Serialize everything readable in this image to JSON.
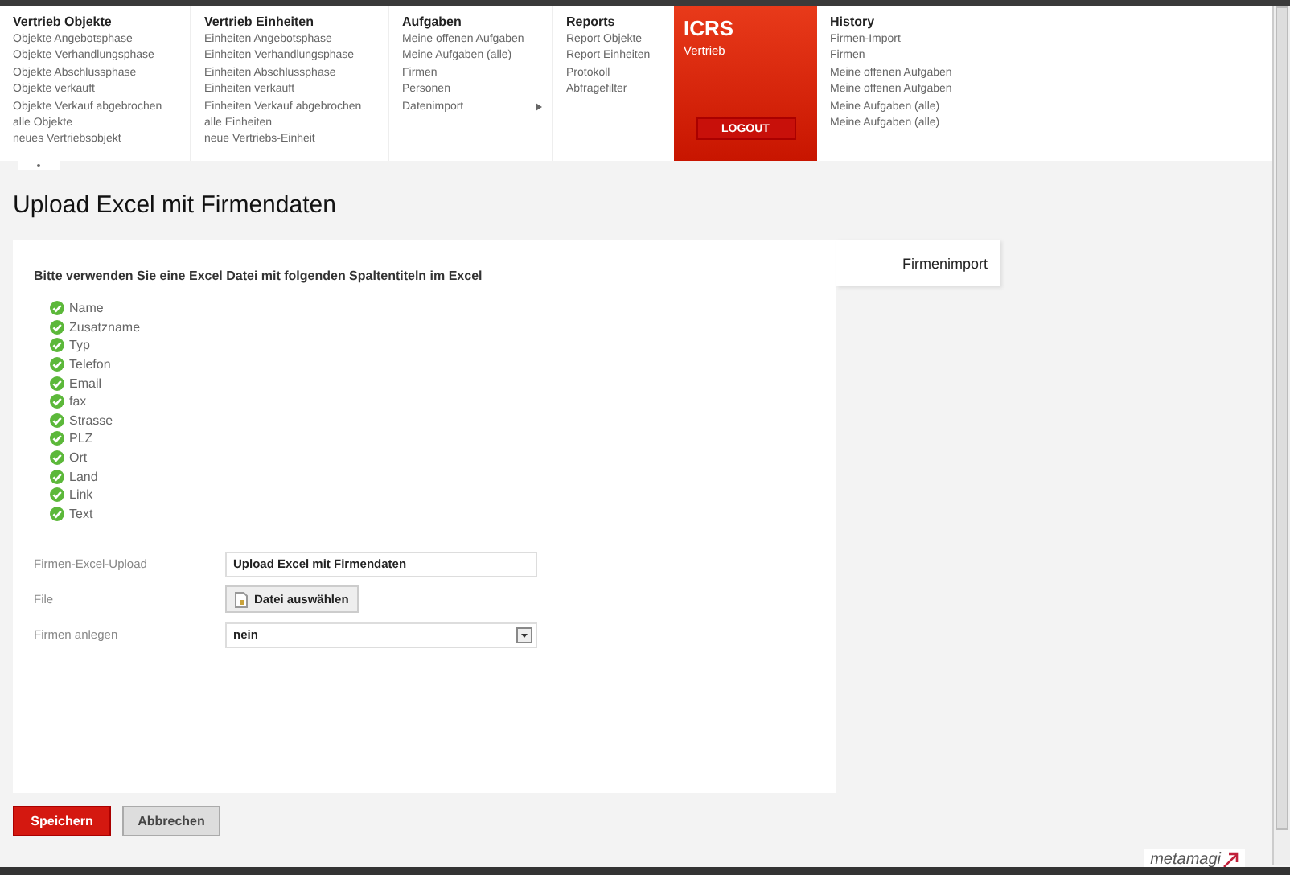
{
  "menu": {
    "columns": [
      {
        "title": "Vertrieb Objekte",
        "items": [
          {
            "label": "Objekte Angebotsphase"
          },
          {
            "label": "Objekte Verhandlungsphase"
          },
          {
            "label": "Objekte Abschlussphase"
          },
          {
            "label": "Objekte verkauft"
          },
          {
            "label": "Objekte Verkauf abgebrochen"
          },
          {
            "label": "alle Objekte"
          },
          {
            "label": "neues Vertriebsobjekt"
          }
        ]
      },
      {
        "title": "Vertrieb Einheiten",
        "items": [
          {
            "label": "Einheiten Angebotsphase"
          },
          {
            "label": "Einheiten Verhandlungsphase"
          },
          {
            "label": "Einheiten Abschlussphase"
          },
          {
            "label": "Einheiten verkauft"
          },
          {
            "label": "Einheiten Verkauf abgebrochen"
          },
          {
            "label": "alle Einheiten"
          },
          {
            "label": "neue Vertriebs-Einheit"
          }
        ]
      },
      {
        "title": "Aufgaben",
        "items": [
          {
            "label": "Meine offenen Aufgaben",
            "submenu": false
          },
          {
            "label": "Meine Aufgaben (alle)",
            "submenu": false
          },
          {
            "label": "Firmen",
            "submenu": false
          },
          {
            "label": "Personen",
            "submenu": false
          },
          {
            "label": "Datenimport",
            "submenu": true
          }
        ]
      },
      {
        "title": "Reports",
        "items": [
          {
            "label": "Report Objekte"
          },
          {
            "label": "Report Einheiten"
          },
          {
            "label": "Protokoll"
          },
          {
            "label": "Abfragefilter"
          }
        ]
      }
    ],
    "brand": {
      "title": "ICRS",
      "subtitle": "Vertrieb",
      "logout": "LOGOUT"
    },
    "history": {
      "title": "History",
      "items": [
        "Firmen-Import",
        "Firmen",
        "Meine offenen Aufgaben",
        "Meine offenen Aufgaben",
        "Meine Aufgaben (alle)",
        "Meine Aufgaben (alle)"
      ]
    }
  },
  "page_title": "Upload Excel mit Firmendaten",
  "side_tab": "Firmenimport",
  "intro": "Bitte verwenden Sie eine Excel Datei mit folgenden Spaltentiteln im Excel",
  "columns": [
    "Name",
    "Zusatzname",
    "Typ",
    "Telefon",
    "Email",
    "fax",
    "Strasse",
    "PLZ",
    "Ort",
    "Land",
    "Link",
    "Text"
  ],
  "form": [
    {
      "kind": "text",
      "label": "Firmen-Excel-Upload",
      "value": "Upload Excel mit Firmendaten"
    },
    {
      "kind": "file",
      "label": "File",
      "value": "Datei auswählen"
    },
    {
      "kind": "select",
      "label": "Firmen anlegen",
      "value": "nein"
    }
  ],
  "buttons": [
    {
      "label": "Speichern",
      "kind": "primary"
    },
    {
      "label": "Abbrechen",
      "kind": "secondary"
    }
  ],
  "footer_logo": "metamagi"
}
